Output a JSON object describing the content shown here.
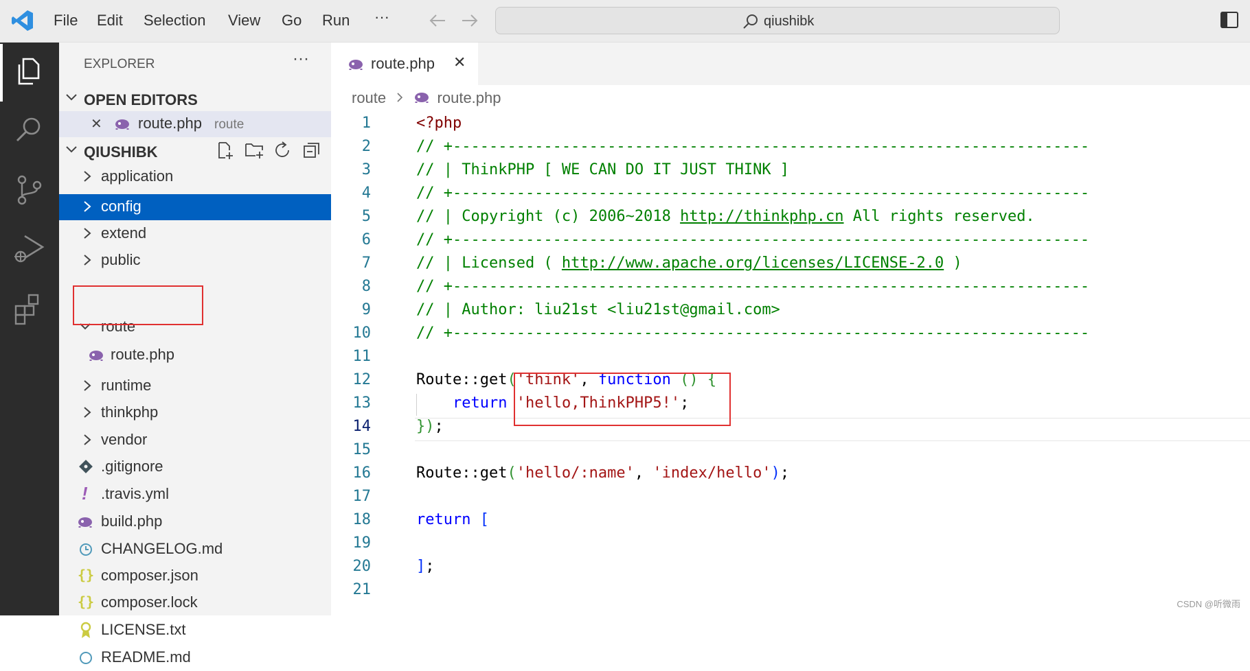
{
  "menu": [
    "File",
    "Edit",
    "Selection",
    "View",
    "Go",
    "Run",
    "···"
  ],
  "search": {
    "text": "qiushibk"
  },
  "sidebar": {
    "header": "EXPLORER",
    "more": "···",
    "open_editors_title": "OPEN EDITORS",
    "open_editor": {
      "file": "route.php",
      "folder": "route"
    },
    "folder_title": "QIUSHIBK",
    "items": [
      {
        "label": "application",
        "kind": "folder"
      },
      {
        "label": "config",
        "kind": "folder",
        "selected": true
      },
      {
        "label": "extend",
        "kind": "folder"
      },
      {
        "label": "public",
        "kind": "folder"
      },
      {
        "label": "route",
        "kind": "folder-open"
      },
      {
        "label": "route.php",
        "kind": "php"
      },
      {
        "label": "runtime",
        "kind": "folder"
      },
      {
        "label": "thinkphp",
        "kind": "folder"
      },
      {
        "label": "vendor",
        "kind": "folder"
      },
      {
        "label": ".gitignore",
        "kind": "git"
      },
      {
        "label": ".travis.yml",
        "kind": "yml"
      },
      {
        "label": "build.php",
        "kind": "php"
      },
      {
        "label": "CHANGELOG.md",
        "kind": "md"
      },
      {
        "label": "composer.json",
        "kind": "json"
      },
      {
        "label": "composer.lock",
        "kind": "json"
      },
      {
        "label": "LICENSE.txt",
        "kind": "license"
      },
      {
        "label": "README.md",
        "kind": "md"
      }
    ]
  },
  "tab": {
    "label": "route.php",
    "close": "✕"
  },
  "breadcrumb": {
    "folder": "route",
    "file": "route.php"
  },
  "code": {
    "line_numbers": [
      "1",
      "2",
      "3",
      "4",
      "5",
      "6",
      "7",
      "8",
      "9",
      "10",
      "11",
      "12",
      "13",
      "14",
      "15",
      "16",
      "17",
      "18",
      "19",
      "20",
      "21"
    ],
    "active_line": 14,
    "lines": {
      "l1": "<?php",
      "l2": "// +----------------------------------------------------------------------",
      "l3": "// | ThinkPHP [ WE CAN DO IT JUST THINK ]",
      "l4": "// +----------------------------------------------------------------------",
      "l5a": "// | Copyright (c) 2006~2018 ",
      "l5b": "http://thinkphp.cn",
      "l5c": " All rights reserved.",
      "l6": "// +----------------------------------------------------------------------",
      "l7a": "// | Licensed ( ",
      "l7b": "http://www.apache.org/licenses/LICENSE-2.0",
      "l7c": " )",
      "l8": "// +----------------------------------------------------------------------",
      "l9": "// | Author: liu21st <liu21st@gmail.com>",
      "l10": "// +----------------------------------------------------------------------",
      "l12a": "Route::get",
      "l12b": "(",
      "l12c": "'think'",
      "l12d": ", ",
      "l12e": "function",
      "l12f": " () {",
      "l13a": "    ",
      "l13b": "return",
      "l13c": " ",
      "l13d": "'hello,ThinkPHP5!'",
      "l13e": ";",
      "l14a": "}",
      "l14b": ")",
      "l14c": ";",
      "l16a": "Route::get",
      "l16b": "(",
      "l16c": "'hello/:name'",
      "l16d": ", ",
      "l16e": "'index/hello'",
      "l16f": ")",
      "l16g": ";",
      "l18a": "return",
      "l18b": " [",
      "l20a": "]",
      "l20b": ";"
    }
  },
  "watermark": "CSDN @听微雨"
}
